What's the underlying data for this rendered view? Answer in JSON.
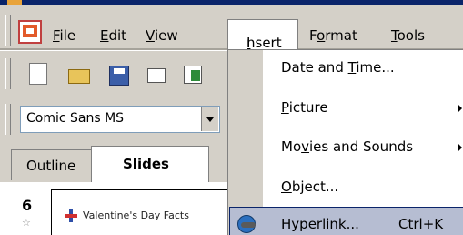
{
  "menubar": {
    "items": [
      {
        "label": "File",
        "accel": "F",
        "rest": "ile"
      },
      {
        "label": "Edit",
        "accel": "E",
        "rest": "dit"
      },
      {
        "label": "View",
        "accel": "V",
        "rest": "iew"
      },
      {
        "label": "Insert",
        "accel": "I",
        "rest": "nsert"
      },
      {
        "label": "Format",
        "pre": "F",
        "accel": "o",
        "rest": "rmat"
      },
      {
        "label": "Tools",
        "accel": "T",
        "rest": "ools"
      }
    ]
  },
  "toolbar": {
    "font_name": "Comic Sans MS"
  },
  "tabs": {
    "outline": "Outline",
    "slides": "Slides"
  },
  "slide_pane": {
    "slide_number": "6",
    "anim_marker": "☆",
    "thumbnail_title": "Valentine's Day Facts"
  },
  "insert_menu": {
    "date_time": {
      "pre": "Date and ",
      "accel": "T",
      "post": "ime..."
    },
    "picture": {
      "pre": "",
      "accel": "P",
      "post": "icture"
    },
    "movies_sounds": {
      "pre": "Mo",
      "accel": "v",
      "post": "ies and Sounds"
    },
    "object": {
      "pre": "",
      "accel": "O",
      "post": "bject..."
    },
    "hyperlink": {
      "pre": "H",
      "accel": "y",
      "post": "perlink...",
      "shortcut": "Ctrl+K"
    }
  }
}
